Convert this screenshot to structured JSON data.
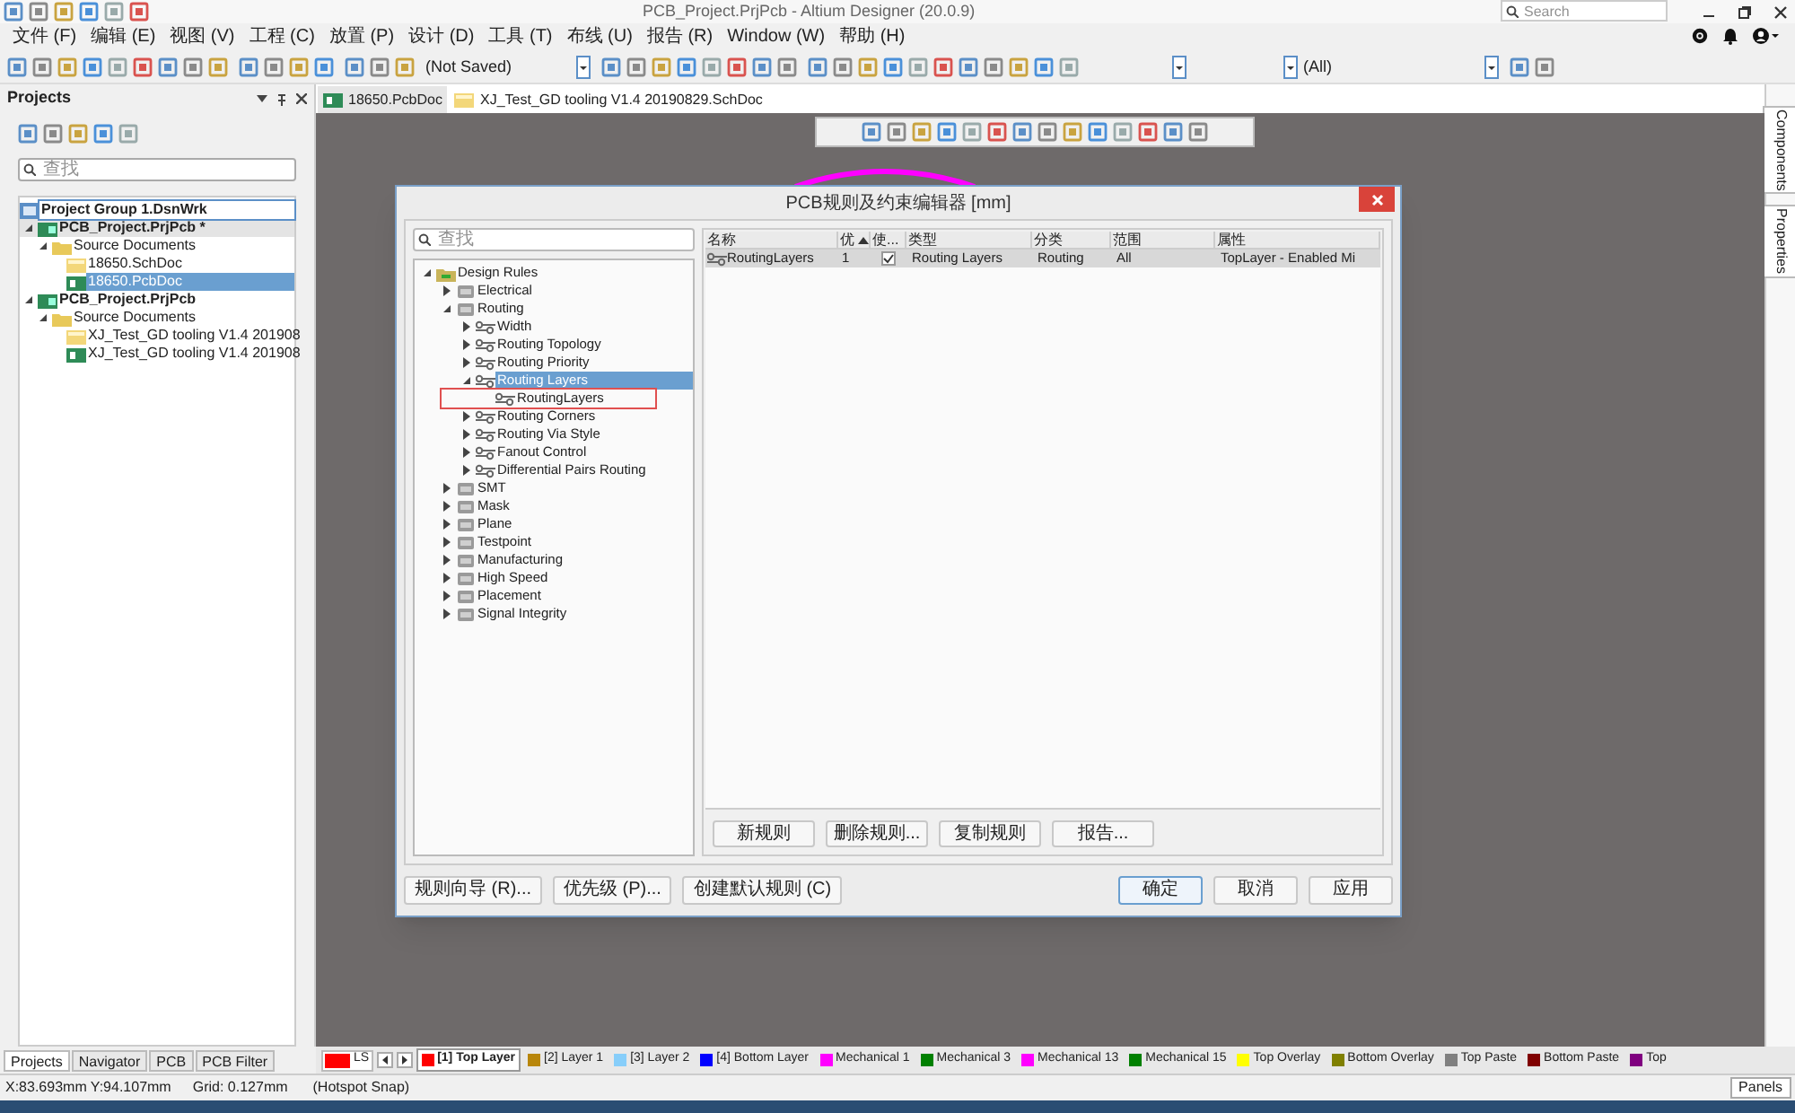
{
  "window": {
    "title": "PCB_Project.PrjPcb - Altium Designer (20.0.9)",
    "search_placeholder": "Search"
  },
  "menu": [
    "文件 (F)",
    "编辑 (E)",
    "视图 (V)",
    "工程 (C)",
    "放置 (P)",
    "设计 (D)",
    "工具 (T)",
    "布线 (U)",
    "报告 (R)",
    "Window (W)",
    "帮助 (H)"
  ],
  "toolbar": {
    "profile": "(Not Saved)",
    "layer_filter": "(All)"
  },
  "projects_panel": {
    "title": "Projects",
    "search_placeholder": "查找",
    "tree": [
      {
        "kind": "workspace",
        "label": "Project Group 1.DsnWrk",
        "selected": false,
        "focused": true
      },
      {
        "kind": "project",
        "label": "PCB_Project.PrjPcb *",
        "selected": false,
        "focused": false,
        "active": true,
        "expanded": true,
        "children": [
          {
            "kind": "folder",
            "label": "Source Documents",
            "selected": false,
            "expanded": true,
            "children": [
              {
                "kind": "sch",
                "label": "18650.SchDoc",
                "selected": false
              },
              {
                "kind": "pcb",
                "label": "18650.PcbDoc",
                "selected": true
              }
            ]
          }
        ]
      },
      {
        "kind": "project",
        "label": "PCB_Project.PrjPcb",
        "selected": false,
        "focused": false,
        "active": false,
        "expanded": true,
        "children": [
          {
            "kind": "folder",
            "label": "Source Documents",
            "selected": false,
            "expanded": true,
            "children": [
              {
                "kind": "sch",
                "label": "XJ_Test_GD tooling V1.4 201908",
                "selected": false
              },
              {
                "kind": "pcb",
                "label": "XJ_Test_GD tooling V1.4 201908",
                "selected": false
              }
            ]
          }
        ]
      }
    ]
  },
  "doc_tabs": [
    {
      "kind": "pcb",
      "label": "18650.PcbDoc",
      "selected": true
    },
    {
      "kind": "sch",
      "label": "XJ_Test_GD tooling V1.4 20190829.SchDoc",
      "selected": false
    }
  ],
  "right_tabs": [
    "Components",
    "Properties"
  ],
  "dialog": {
    "title": "PCB规则及约束编辑器 [mm]",
    "search_placeholder": "查找",
    "tree": [
      {
        "label": "Design Rules",
        "selected": false,
        "expanded": true,
        "children": [
          {
            "label": "Electrical",
            "selected": false,
            "expanded": false
          },
          {
            "label": "Routing",
            "selected": false,
            "expanded": true,
            "children": [
              {
                "label": "Width",
                "selected": false,
                "expanded": false
              },
              {
                "label": "Routing Topology",
                "selected": false,
                "expanded": false
              },
              {
                "label": "Routing Priority",
                "selected": false,
                "expanded": false
              },
              {
                "label": "Routing Layers",
                "selected": true,
                "expanded": true,
                "children": [
                  {
                    "label": "RoutingLayers",
                    "selected": false,
                    "marked": true
                  }
                ]
              },
              {
                "label": "Routing Corners",
                "selected": false,
                "expanded": false
              },
              {
                "label": "Routing Via Style",
                "selected": false,
                "expanded": false
              },
              {
                "label": "Fanout Control",
                "selected": false,
                "expanded": false
              },
              {
                "label": "Differential Pairs Routing",
                "selected": false,
                "expanded": false
              }
            ]
          },
          {
            "label": "SMT",
            "selected": false,
            "expanded": false
          },
          {
            "label": "Mask",
            "selected": false,
            "expanded": false
          },
          {
            "label": "Plane",
            "selected": false,
            "expanded": false
          },
          {
            "label": "Testpoint",
            "selected": false,
            "expanded": false
          },
          {
            "label": "Manufacturing",
            "selected": false,
            "expanded": false
          },
          {
            "label": "High Speed",
            "selected": false,
            "expanded": false
          },
          {
            "label": "Placement",
            "selected": false,
            "expanded": false
          },
          {
            "label": "Signal Integrity",
            "selected": false,
            "expanded": false
          }
        ]
      }
    ],
    "table": {
      "columns": [
        {
          "label": "名称",
          "sorted": false
        },
        {
          "label": "优",
          "sorted": true
        },
        {
          "label": "使...",
          "sorted": false
        },
        {
          "label": "类型",
          "sorted": false
        },
        {
          "label": "分类",
          "sorted": false
        },
        {
          "label": "范围",
          "sorted": false
        },
        {
          "label": "属性",
          "sorted": false
        }
      ],
      "rows": [
        {
          "name": "RoutingLayers",
          "priority": "1",
          "enabled": true,
          "type": "Routing Layers",
          "category": "Routing",
          "scope": "All",
          "attributes": "TopLayer - Enabled Mi",
          "selected": true
        }
      ]
    },
    "rule_buttons": [
      "新规则",
      "删除规则...",
      "复制规则",
      "报告..."
    ],
    "footer_left": [
      "规则向导 (R)...",
      "优先级 (P)...",
      "创建默认规则 (C)"
    ],
    "footer_right": [
      {
        "label": "确定",
        "default": true
      },
      {
        "label": "取消",
        "default": false
      },
      {
        "label": "应用",
        "default": false
      }
    ]
  },
  "panel_tabs": [
    {
      "label": "Projects",
      "selected": true
    },
    {
      "label": "Navigator",
      "selected": false
    },
    {
      "label": "PCB",
      "selected": false
    },
    {
      "label": "PCB Filter",
      "selected": false
    }
  ],
  "layer_set": {
    "label": "LS",
    "color": "#ff0000"
  },
  "layer_tabs": [
    {
      "label": "[1] Top Layer",
      "color": "#ff0000",
      "selected": true
    },
    {
      "label": "[2] Layer 1",
      "color": "#b8860b",
      "selected": false
    },
    {
      "label": "[3] Layer 2",
      "color": "#87cefa",
      "selected": false
    },
    {
      "label": "[4] Bottom Layer",
      "color": "#0000ff",
      "selected": false
    },
    {
      "label": "Mechanical 1",
      "color": "#ff00ff",
      "selected": false
    },
    {
      "label": "Mechanical 3",
      "color": "#008000",
      "selected": false
    },
    {
      "label": "Mechanical 13",
      "color": "#ff00ff",
      "selected": false
    },
    {
      "label": "Mechanical 15",
      "color": "#008000",
      "selected": false
    },
    {
      "label": "Top Overlay",
      "color": "#ffff00",
      "selected": false
    },
    {
      "label": "Bottom Overlay",
      "color": "#808000",
      "selected": false
    },
    {
      "label": "Top Paste",
      "color": "#808080",
      "selected": false
    },
    {
      "label": "Bottom Paste",
      "color": "#800000",
      "selected": false
    },
    {
      "label": "Top",
      "color": "#800080",
      "selected": false
    }
  ],
  "status": [
    "X:83.693mm Y:94.107mm",
    "Grid: 0.127mm",
    "(Hotspot Snap)"
  ],
  "panels_button": "Panels"
}
